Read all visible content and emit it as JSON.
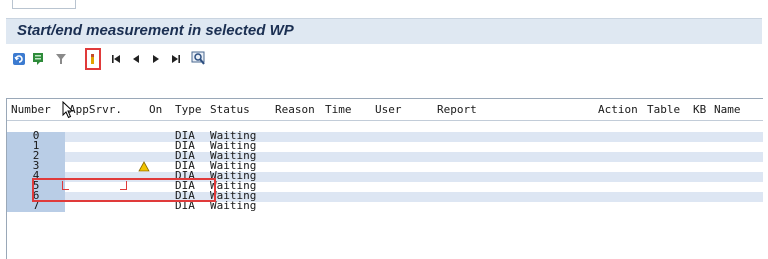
{
  "title": "Start/end measurement in selected WP",
  "toolbar": {
    "buttons": [
      {
        "name": "refresh-icon",
        "color": "#3c7bd0"
      },
      {
        "name": "details-icon",
        "color": "#2e8b3a"
      },
      {
        "name": "filter-icon",
        "color": "#7a7a7a"
      },
      {
        "name": "measurement-toggle-icon",
        "color": "#e2a300"
      },
      {
        "name": "first-page-icon"
      },
      {
        "name": "previous-page-icon"
      },
      {
        "name": "next-page-icon"
      },
      {
        "name": "last-page-icon"
      },
      {
        "name": "find-icon"
      }
    ]
  },
  "table": {
    "columns": [
      "Number",
      "AppSrvr.",
      "On",
      "Type",
      "Status",
      "Reason",
      "Time",
      "User",
      "Report",
      "Action",
      "Table",
      "KB",
      "Name"
    ],
    "rows": [
      {
        "number": "0",
        "type": "DIA",
        "status": "Waiting"
      },
      {
        "number": "1",
        "type": "DIA",
        "status": "Waiting"
      },
      {
        "number": "2",
        "type": "DIA",
        "status": "Waiting"
      },
      {
        "number": "3",
        "type": "DIA",
        "status": "Waiting",
        "warning": true
      },
      {
        "number": "4",
        "type": "DIA",
        "status": "Waiting"
      },
      {
        "number": "5",
        "type": "DIA",
        "status": "Waiting"
      },
      {
        "number": "6",
        "type": "DIA",
        "status": "Waiting"
      },
      {
        "number": "7",
        "type": "DIA",
        "status": "Waiting"
      }
    ]
  },
  "colors": {
    "highlight": "#e03a3a",
    "title_bg": "#dfe8f2",
    "row_alt": "#dde6f3",
    "number_cell": "#b9cde6",
    "warning": "#f2c400"
  }
}
